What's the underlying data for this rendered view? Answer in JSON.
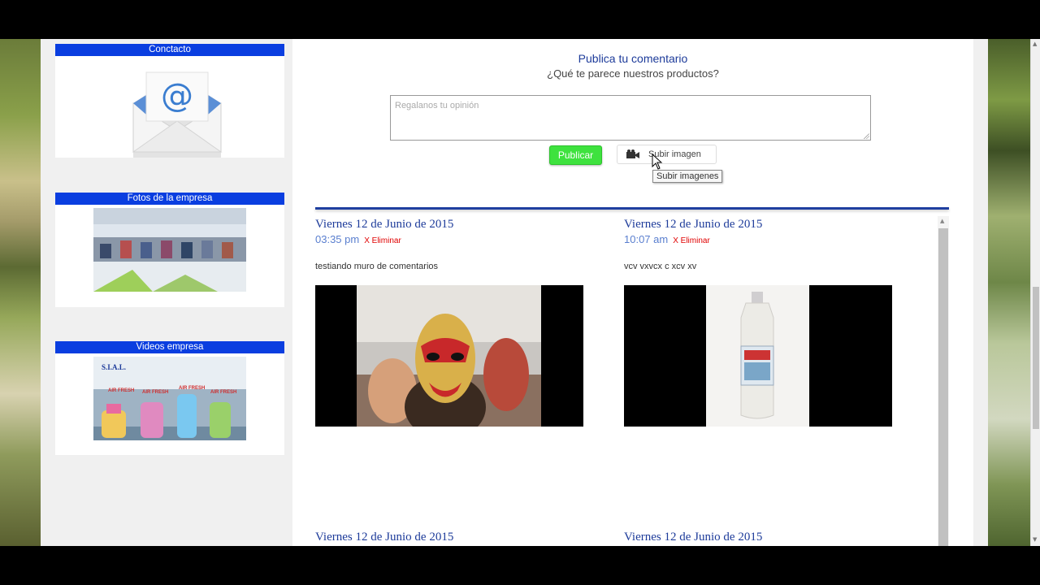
{
  "sidebar": {
    "contact_title": "Conctacto",
    "photos_title": "Fotos de la empresa",
    "videos_title": "Videos empresa",
    "video_thumb_brand": "S.I.A.L.",
    "video_thumb_products": [
      "AIR FRESH",
      "AIR FRESH",
      "AIR FRESH",
      "AIR FRESH"
    ]
  },
  "comment_form": {
    "title": "Publica tu comentario",
    "subtitle": "¿Qué te parece nuestros productos?",
    "placeholder": "Regalanos tu opinión",
    "publish_label": "Publicar",
    "upload_label": "Subir imagen",
    "tooltip": "Subir imagenes"
  },
  "posts": [
    {
      "date": "Viernes 12 de Junio de 2015",
      "time": "03:35 pm",
      "delete_label": "X Eliminar",
      "text": "testiando muro de comentarios"
    },
    {
      "date": "Viernes 12 de Junio de 2015",
      "time": "10:07 am",
      "delete_label": "X Eliminar",
      "text": "vcv vxvcx c xcv xv"
    },
    {
      "date": "Viernes 12 de Junio de 2015"
    },
    {
      "date": "Viernes 12 de Junio de 2015"
    }
  ],
  "colors": {
    "sidebar_title_bg": "#0a3ee0",
    "title_blue": "#1d3b9a",
    "publish_green": "#3ee23e",
    "delete_red": "#e00000"
  }
}
